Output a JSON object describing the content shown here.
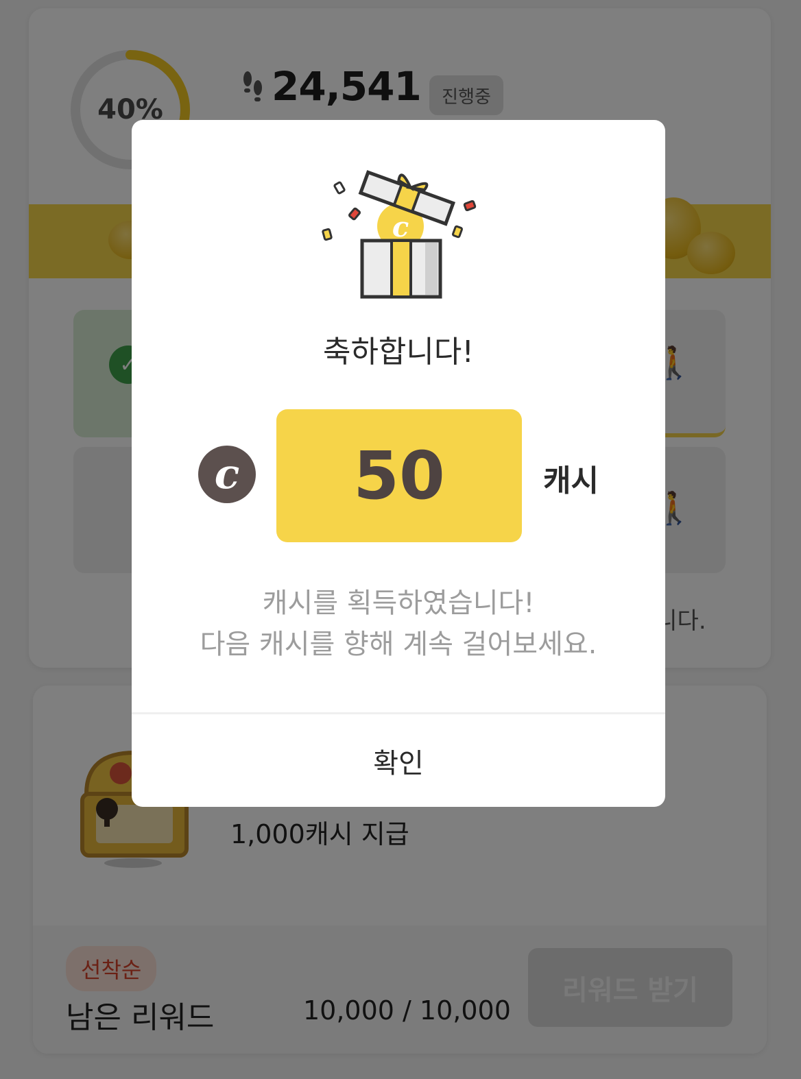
{
  "background": {
    "progress": {
      "percent_label": "40%",
      "fraction": 0.4
    },
    "step_count": "24,541",
    "status_badge": "진행중",
    "partial_note": "립니다.",
    "reward_card": {
      "reward_text": "1,000캐시 지급",
      "first_come_badge": "선착순",
      "remaining_label": "남은 리워드",
      "remaining_count": "10,000 / 10,000",
      "claim_button": "리워드 받기"
    }
  },
  "modal": {
    "title": "축하합니다!",
    "coin_symbol": "c",
    "amount": "50",
    "unit": "캐시",
    "message_line1": "캐시를 획득하였습니다!",
    "message_line2": "다음 캐시를 향해 계속 걸어보세요.",
    "confirm_button": "확인"
  },
  "colors": {
    "accent_yellow": "#f6d449",
    "coin_brown": "#5c504e",
    "success_green": "#3fa14a",
    "badge_red": "#d6432a"
  }
}
